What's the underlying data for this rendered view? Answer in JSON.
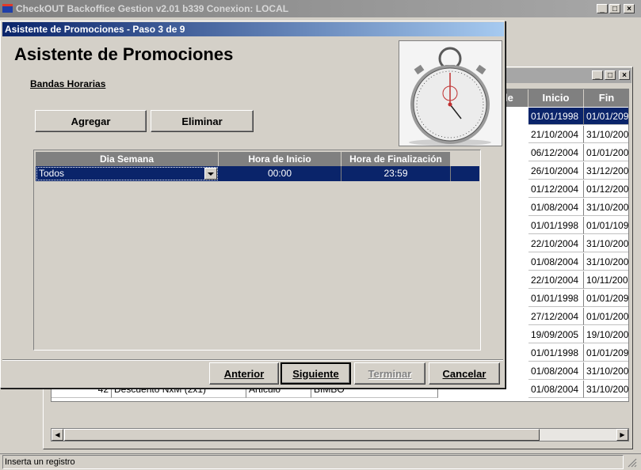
{
  "app": {
    "title": "CheckOUT Backoffice Gestion v2.01 b339 Conexion: LOCAL",
    "controls": {
      "minimize": "_",
      "maximize": "□",
      "close": "×"
    }
  },
  "background_list": {
    "columns": [
      "le",
      "Inicio",
      "Fin"
    ],
    "rows": [
      {
        "inicio": "01/01/1998",
        "fin": "01/01/209"
      },
      {
        "inicio": "21/10/2004",
        "fin": "31/10/200"
      },
      {
        "inicio": "06/12/2004",
        "fin": "01/01/200"
      },
      {
        "inicio": "26/10/2004",
        "fin": "31/12/200"
      },
      {
        "inicio": "01/12/2004",
        "fin": "01/12/200"
      },
      {
        "inicio": "01/08/2004",
        "fin": "31/10/200"
      },
      {
        "inicio": "01/01/1998",
        "fin": "01/01/109"
      },
      {
        "inicio": "22/10/2004",
        "fin": "31/10/200"
      },
      {
        "inicio": "01/08/2004",
        "fin": "31/10/200"
      },
      {
        "inicio": "22/10/2004",
        "fin": "10/11/200"
      },
      {
        "inicio": "01/01/1998",
        "fin": "01/01/209"
      },
      {
        "inicio": "27/12/2004",
        "fin": "01/01/200"
      },
      {
        "inicio": "19/09/2005",
        "fin": "19/10/200"
      },
      {
        "inicio": "01/01/1998",
        "fin": "01/01/209"
      },
      {
        "inicio": "01/08/2004",
        "fin": "31/10/200"
      },
      {
        "inicio": "01/08/2004",
        "fin": "31/10/200"
      }
    ],
    "partial_row": {
      "id": "42",
      "nombre": "Descuento NxM (2x1)",
      "tipo": "Articulo",
      "marca": "BIMBO"
    }
  },
  "status_bar": {
    "text": "Inserta un registro"
  },
  "wizard": {
    "window_title": "Asistente de Promociones - Paso 3 de 9",
    "heading": "Asistente de Promociones",
    "subheading": "Bandas Horarias",
    "add_label": "Agregar",
    "delete_label": "Eliminar",
    "grid": {
      "columns": [
        "Dia Semana",
        "Hora de Inicio",
        "Hora de Finalización"
      ],
      "rows": [
        {
          "dia": "Todos",
          "inicio": "00:00",
          "fin": "23:59"
        }
      ]
    },
    "nav": {
      "prev_label": "Anterior",
      "next_label": "Siguiente",
      "finish_label": "Terminar",
      "cancel_label": "Cancelar"
    }
  }
}
